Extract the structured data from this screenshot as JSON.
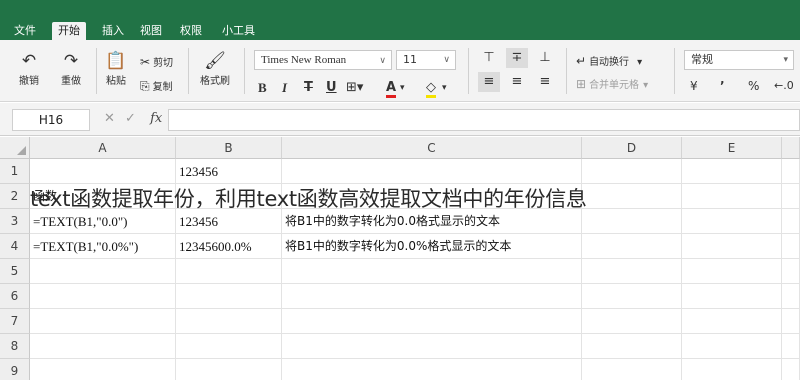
{
  "menubar": {
    "items": [
      {
        "label": "文件",
        "active": false
      },
      {
        "label": "开始",
        "active": true
      },
      {
        "label": "插入",
        "active": false
      },
      {
        "label": "视图",
        "active": false
      },
      {
        "label": "权限",
        "active": false
      },
      {
        "label": "小工具",
        "active": false
      }
    ]
  },
  "ribbon": {
    "undo": "撤销",
    "redo": "重做",
    "paste": "粘贴",
    "cut": "剪切",
    "copy": "复制",
    "format_painter": "格式刷",
    "font_name": "Times New Roman",
    "font_size": "11",
    "bold": "B",
    "italic": "I",
    "strike": "T",
    "underline": "U",
    "font_color_letter": "A",
    "wrap_text": "自动换行",
    "merge_cells": "合并单元格",
    "number_format": "常规",
    "currency": "¥"
  },
  "formula_bar": {
    "name_box": "H16",
    "fx": "fx",
    "formula": ""
  },
  "grid": {
    "columns": [
      "A",
      "B",
      "C",
      "D",
      "E"
    ],
    "rows": [
      "1",
      "2",
      "3",
      "4",
      "5",
      "6",
      "7",
      "8",
      "9"
    ],
    "cells": {
      "B1": "123456",
      "A2": "函数",
      "A3": "=TEXT(B1,\"0.0\")",
      "B3": "123456",
      "C3": "将B1中的数字转化为0.0格式显示的文本",
      "A4": "=TEXT(B1,\"0.0%\")",
      "B4": "12345600.0%",
      "C4": "将B1中的数字转化为0.0%格式显示的文本"
    }
  },
  "overlay_title": "text函数提取年份，利用text函数高效提取文档中的年份信息",
  "colors": {
    "menubar_bg": "#217346",
    "ribbon_bg": "#f3f3f3",
    "font_color_underline": "#e02020",
    "fill_color_underline": "#f5e200"
  }
}
